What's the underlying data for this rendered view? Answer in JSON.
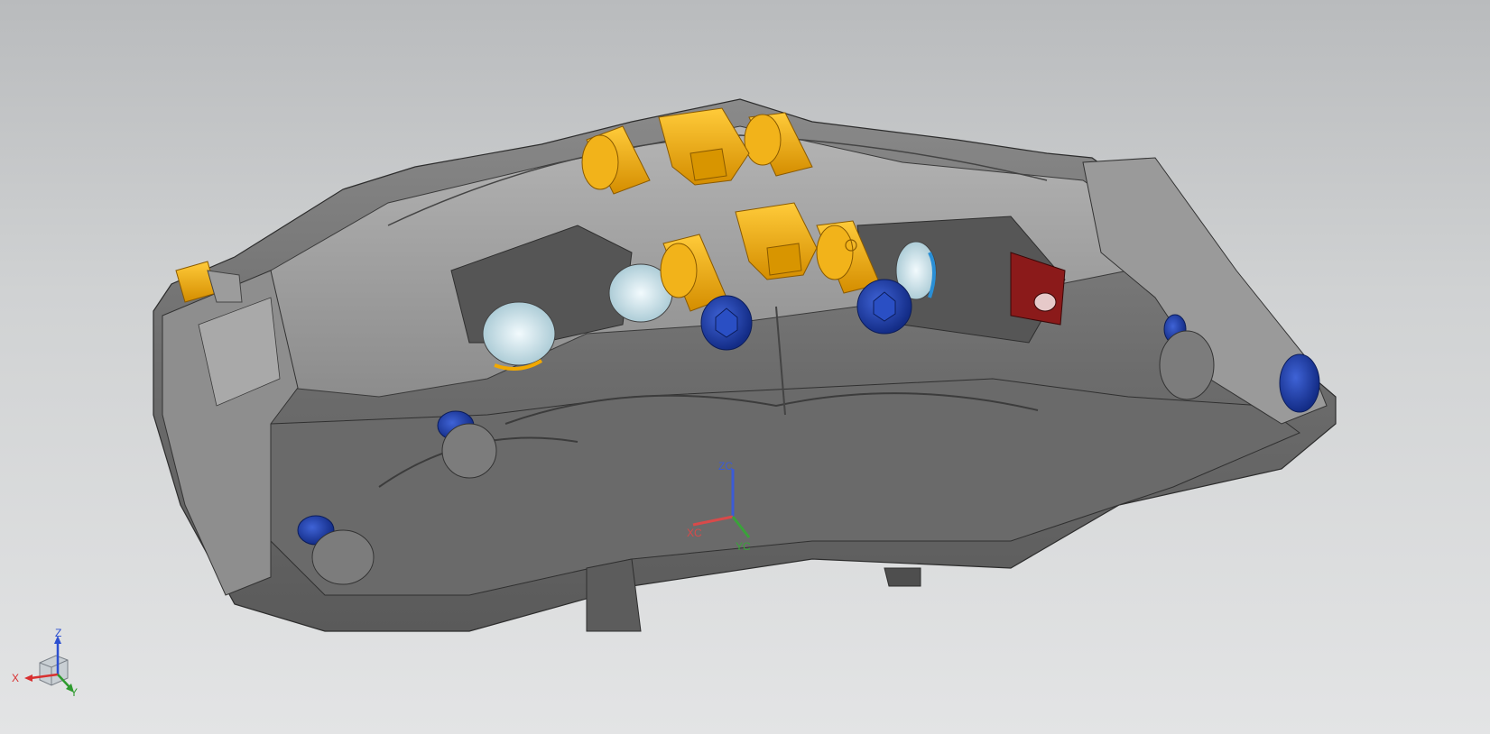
{
  "viewport": {
    "background_top": "#b9bbbd",
    "background_bottom": "#e3e4e5"
  },
  "model": {
    "body_color": "#6b6b6b",
    "body_light": "#a3a3a3",
    "pin_color": "#f2a900",
    "bolt_color": "#1b3ea8",
    "bracket_color": "#8b1a1a",
    "piston_color": "#cfe3ea"
  },
  "wcs_triad": {
    "x_label": "XC",
    "y_label": "YC",
    "z_label": "ZC",
    "x_color": "#d84a4a",
    "y_color": "#3aa33a",
    "z_color": "#3b5bd6"
  },
  "view_triad": {
    "x_label": "X",
    "y_label": "Y",
    "z_label": "Z",
    "x_color": "#d83030",
    "y_color": "#2e9a2e",
    "z_color": "#2c4fd0",
    "icon": "view-orientation-cube-icon"
  }
}
